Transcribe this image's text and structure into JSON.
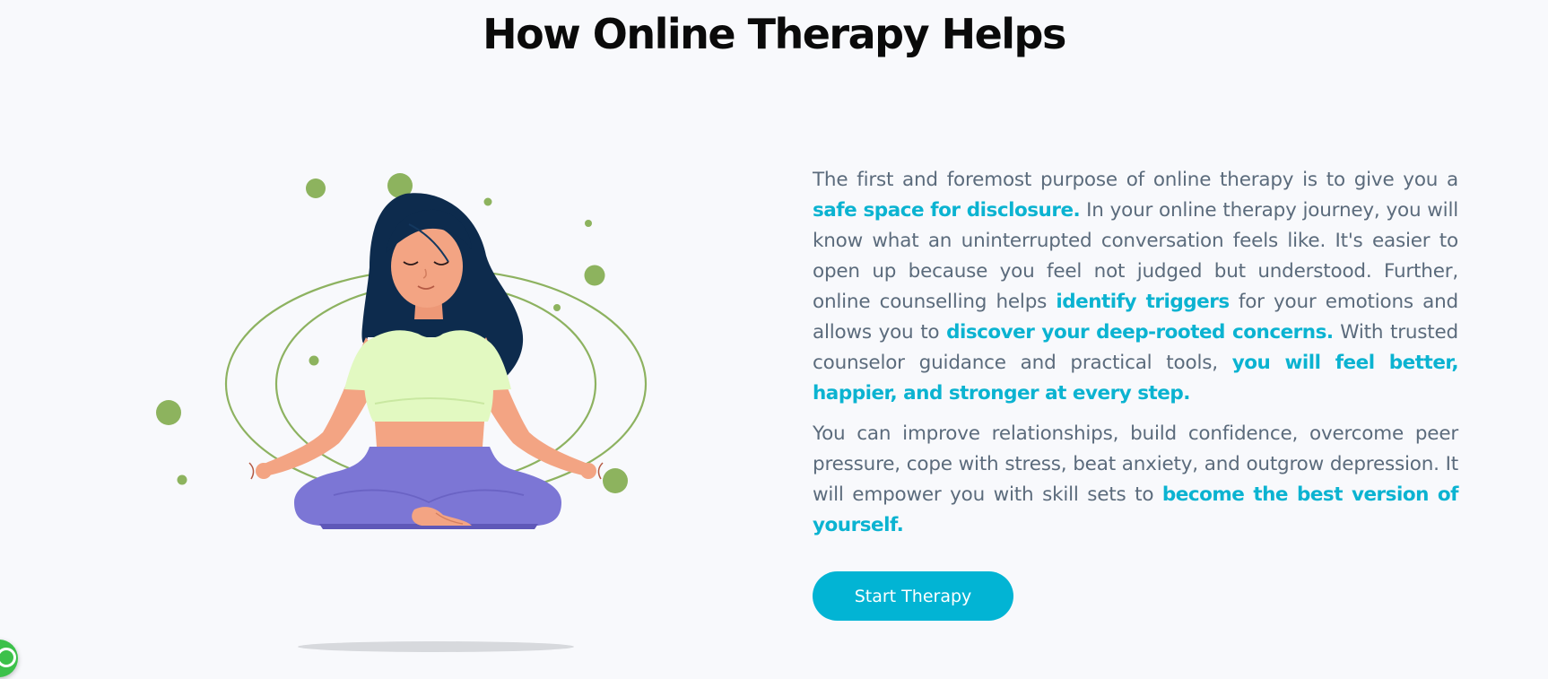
{
  "section": {
    "title": "How Online Therapy Helps"
  },
  "illustration": {
    "icon": "meditating-woman-icon",
    "colors": {
      "rings": "#8db260",
      "dots": "#8db35e",
      "hair": "#0d2b4d",
      "skin": "#f3a483",
      "top": "#e2f9c1",
      "pants": "#7c76d5",
      "shadow": "#d7d9dd"
    }
  },
  "paragraphs": {
    "p1": {
      "t1": "The first and foremost purpose of online therapy is to give you a ",
      "h1": "safe space for disclosure.",
      "t2": " In your online therapy journey, you will know what an uninterrupted conversation feels like. It's easier to open up because you feel not judged but understood. Further, online counselling helps ",
      "h2": "identify triggers",
      "t3": " for your emotions and allows you to ",
      "h3": "discover your deep-rooted concerns.",
      "t4": " With trusted counselor guidance and practical tools, ",
      "h4": "you will feel better, happier, and stronger at every step."
    },
    "p2": {
      "t1": "You can improve relationships, build confidence, overcome peer pressure, cope with stress, beat anxiety, and outgrow depression. It will empower you with skill sets to ",
      "h1": "become the best version of yourself."
    }
  },
  "cta": {
    "label": "Start Therapy"
  },
  "chat_widget": {
    "icon": "whatsapp-icon"
  },
  "colors": {
    "background": "#f8f9fc",
    "heading": "#0a0a0a",
    "body_text": "#5b6b7c",
    "accent": "#0bb3d1",
    "button": "#02b4d4",
    "chat_badge": "#3cc14a"
  }
}
